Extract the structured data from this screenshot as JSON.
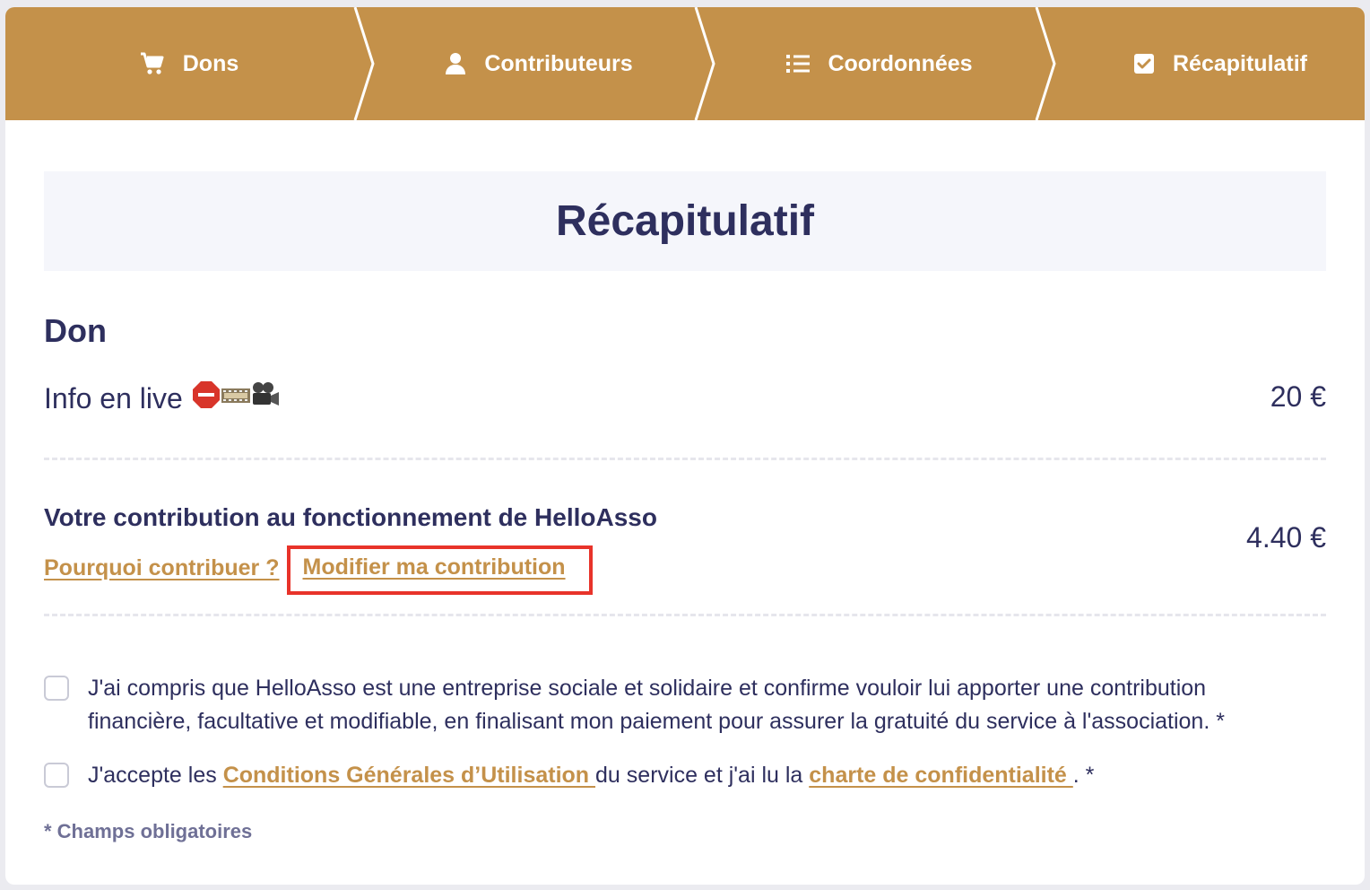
{
  "stepper": {
    "steps": [
      {
        "label": "Dons",
        "icon": "cart-icon"
      },
      {
        "label": "Contributeurs",
        "icon": "user-icon"
      },
      {
        "label": "Coordonnées",
        "icon": "list-icon"
      },
      {
        "label": "Récapitulatif",
        "icon": "checkbox-checked-icon"
      }
    ]
  },
  "title": "Récapitulatif",
  "don": {
    "section_title": "Don",
    "name": "Info en live",
    "emojis": [
      "stop-sign-icon",
      "film-strip-icon",
      "movie-camera-icon"
    ],
    "amount": "20 €"
  },
  "contribution": {
    "title": "Votre contribution au fonctionnement de HelloAsso",
    "why_link": "Pourquoi contribuer ?",
    "modify_link": "Modifier ma contribution",
    "amount": "4.40 €"
  },
  "checkboxes": {
    "solidarity": {
      "text": "J'ai compris que HelloAsso est une entreprise sociale et solidaire et confirme vouloir lui apporter une contribution financière, facultative et modifiable, en finalisant mon paiement pour assurer la gratuité du service à l'association. *"
    },
    "cgu": {
      "prefix": "J'accepte les ",
      "cgu_link": "Conditions Générales d’Utilisation ",
      "middle": "du service et j'ai lu la ",
      "privacy_link": "charte de confidentialité ",
      "suffix": ". *"
    }
  },
  "mandatory_note": "* Champs obligatoires",
  "colors": {
    "accent": "#c4914a",
    "text": "#2e2f5e",
    "highlight": "#e8332a"
  }
}
